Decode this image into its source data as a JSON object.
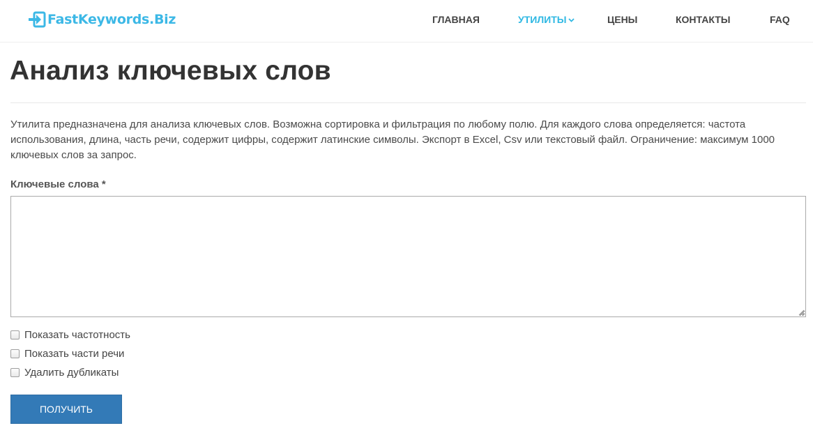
{
  "header": {
    "logo_text": "FastKeywords.Biz",
    "nav": [
      {
        "label": "Главная"
      },
      {
        "label": "Утилиты"
      },
      {
        "label": "Цены"
      },
      {
        "label": "Контакты"
      },
      {
        "label": "FAQ"
      }
    ]
  },
  "main": {
    "title": "Анализ ключевых слов",
    "description": "Утилита предназначена для анализа ключевых слов. Возможна сортировка и фильтрация по любому полю. Для каждого слова определяется: частота использования, длина, часть речи, содержит цифры, содержит латинские символы. Экспорт в Excel, Csv или текстовый файл. Ограничение: максимум 1000 ключевых слов за запрос.",
    "keywords_label": "Ключевые слова *",
    "keywords_value": "",
    "options": [
      {
        "label": "Показать частотность",
        "checked": false
      },
      {
        "label": "Показать части речи",
        "checked": false
      },
      {
        "label": "Удалить дубликаты",
        "checked": false
      }
    ],
    "submit_label": "Получить"
  },
  "colors": {
    "accent": "#2fb8e3",
    "button": "#337ab7",
    "text": "#333333"
  },
  "icons": {
    "logo": "login-arrow-icon",
    "dropdown": "chevron-down-icon"
  }
}
